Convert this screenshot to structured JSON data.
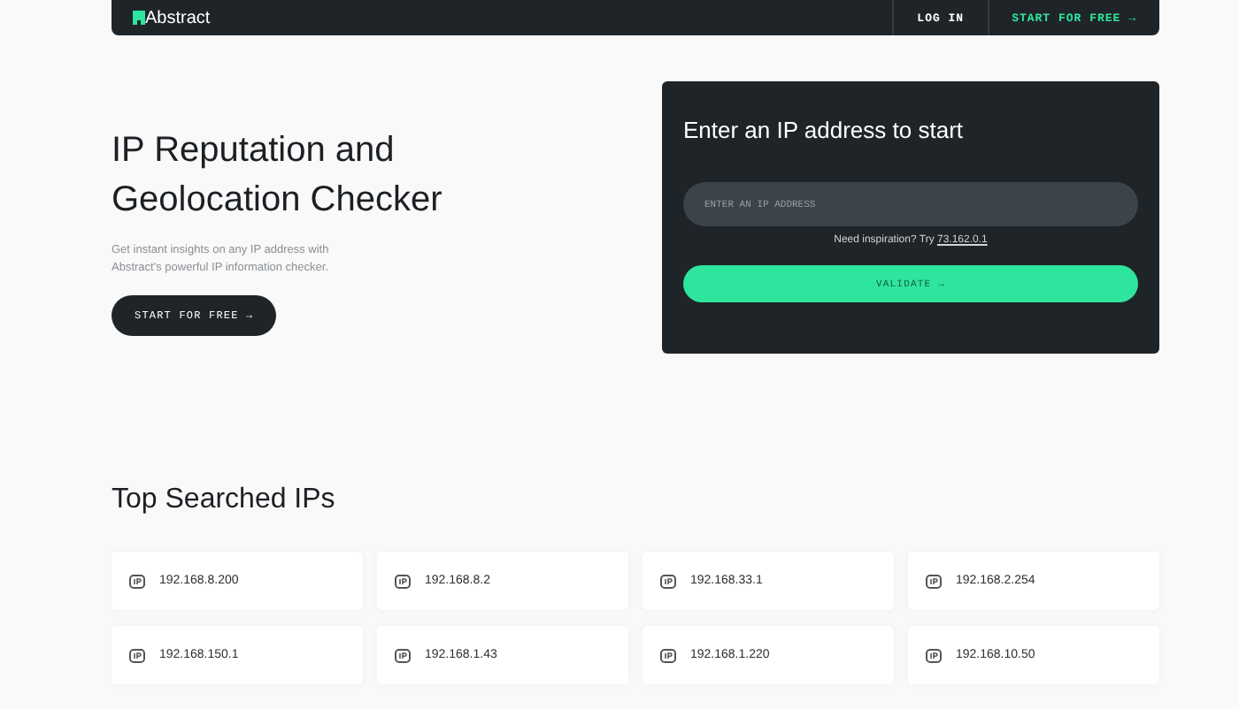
{
  "nav": {
    "logo": "Abstract",
    "links": [
      {
        "text": "LOG IN",
        "kind": "plain"
      },
      {
        "text": "START FOR FREE →",
        "kind": "accent"
      }
    ]
  },
  "hero": {
    "title": "IP Reputation and Geolocation Checker",
    "description": "Get instant insights on any IP address with Abstract's powerful IP information checker.",
    "cta": "START FOR FREE →"
  },
  "checker": {
    "title": "Enter an IP address to start",
    "placeholder": "ENTER AN IP ADDRESS",
    "hint": "Need inspiration? Try",
    "example": "73.162.0.1",
    "button": "VALIDATE →"
  },
  "top_searched": {
    "heading": "Top Searched IPs",
    "ips": [
      "192.168.8.200",
      "192.168.8.2",
      "192.168.33.1",
      "192.168.2.254",
      "192.168.150.1",
      "192.168.1.43",
      "192.168.1.220",
      "192.168.10.50"
    ]
  }
}
